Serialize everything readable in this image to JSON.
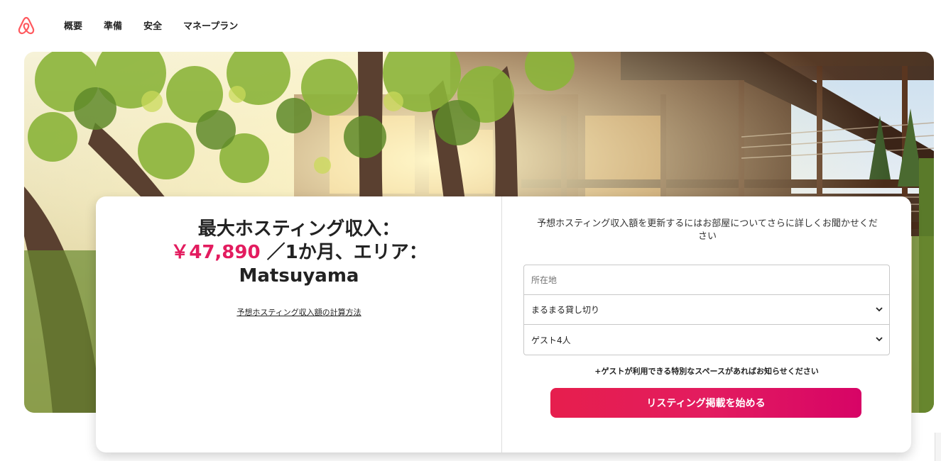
{
  "nav": {
    "logo_icon": "airbnb-logo-icon",
    "brand_color": "#ff5a5f",
    "links": [
      "概要",
      "準備",
      "安全",
      "マネープラン"
    ]
  },
  "hero": {
    "image_description_icon": "treehouse-photo"
  },
  "estimate": {
    "line1": "最大ホスティング収入：",
    "amount": "￥47,890",
    "line2_rest": "／1か月、エリア：",
    "area": "Matsuyama",
    "calc_link": "予想ホスティング収入額の計算方法"
  },
  "form": {
    "prompt": "予想ホスティング収入額を更新するにはお部屋についてさらに詳しくお聞かせください",
    "location_placeholder": "所在地",
    "room_type": "まるまる貸し切り",
    "guests": "ゲスト4人",
    "hint": "+ゲストが利用できる特別なスペースがあればお知らせください",
    "cta_label": "リスティング掲載を始める"
  },
  "colors": {
    "accent": "#e31c5f",
    "text": "#222222"
  }
}
